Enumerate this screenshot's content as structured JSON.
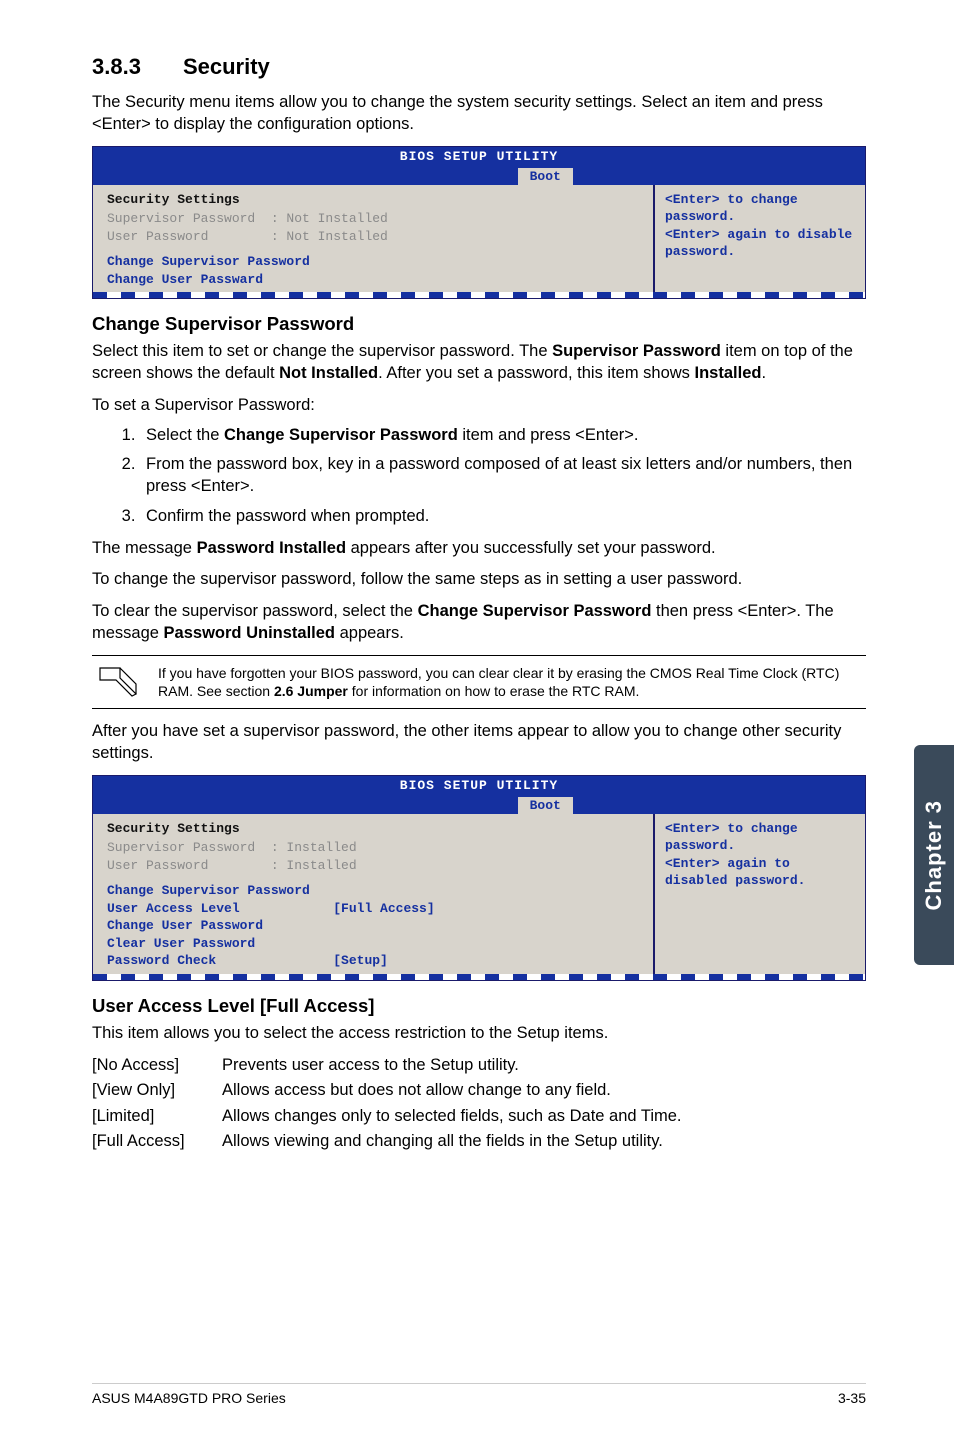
{
  "sidetab": "Chapter 3",
  "section": {
    "num": "3.8.3",
    "title": "Security"
  },
  "intro": "The Security menu items allow you to change the system security settings. Select an item and press <Enter> to display the configuration options.",
  "bios1": {
    "title": "BIOS SETUP UTILITY",
    "tab": "Boot",
    "heading": "Security Settings",
    "row1a": "Supervisor Password  : Not Installed",
    "row1b": "User Password        : Not Installed",
    "row2a": "Change Supervisor Password",
    "row2b": "Change User Passward",
    "help": "<Enter> to change password.\n<Enter> again to disable password."
  },
  "csp": {
    "heading": "Change Supervisor Password",
    "p1a": "Select this item to set or change the supervisor password. The ",
    "p1b": "Supervisor Password",
    "p1c": " item on top of the screen shows the default ",
    "p1d": "Not Installed",
    "p1e": ". After you set a password, this item shows ",
    "p1f": "Installed",
    "p1g": ".",
    "p2": "To set a Supervisor Password:",
    "li1a": "Select the ",
    "li1b": "Change Supervisor Password",
    "li1c": " item and press <Enter>.",
    "li2": "From the password box, key in a password composed of at least six letters and/or numbers, then press <Enter>.",
    "li3": "Confirm the password when prompted.",
    "p3a": "The message ",
    "p3b": "Password Installed",
    "p3c": " appears after you successfully set your password.",
    "p4": "To change the supervisor password, follow the same steps as in setting a user password.",
    "p5a": "To clear the supervisor password, select the ",
    "p5b": "Change Supervisor Password",
    "p5c": " then press <Enter>. The message ",
    "p5d": "Password Uninstalled",
    "p5e": " appears."
  },
  "note": {
    "t1": "If you have forgotten your BIOS password, you can clear clear it by erasing the CMOS Real Time Clock (RTC) RAM. See section ",
    "t2": "2.6 Jumper",
    "t3": " for information on how to erase the RTC RAM."
  },
  "after": "After you have set a supervisor password, the other items appear to allow you to change other security settings.",
  "bios2": {
    "title": "BIOS SETUP UTILITY",
    "tab": "Boot",
    "heading": "Security Settings",
    "row1a": "Supervisor Password  : Installed",
    "row1b": "User Password        : Installed",
    "row2a": "Change Supervisor Password",
    "row2b": "User Access Level            [Full Access]",
    "row2c": "Change User Password",
    "row2d": "Clear User Password",
    "row2e": "Password Check               [Setup]",
    "help": "<Enter> to change password.\n<Enter> again to disabled password."
  },
  "ual": {
    "heading": "User Access Level [Full Access]",
    "p1": "This item allows you to select the access restriction to the Setup items.",
    "r1t": "[No Access]",
    "r1d": "Prevents user access to the Setup utility.",
    "r2t": "[View Only]",
    "r2d": "Allows access but does not allow change to any field.",
    "r3t": "[Limited]",
    "r3d": "Allows changes only to selected fields, such as Date and Time.",
    "r4t": "[Full Access]",
    "r4d": "Allows viewing and changing all the fields in the Setup utility."
  },
  "footer": {
    "left": "ASUS M4A89GTD PRO Series",
    "right": "3-35"
  }
}
